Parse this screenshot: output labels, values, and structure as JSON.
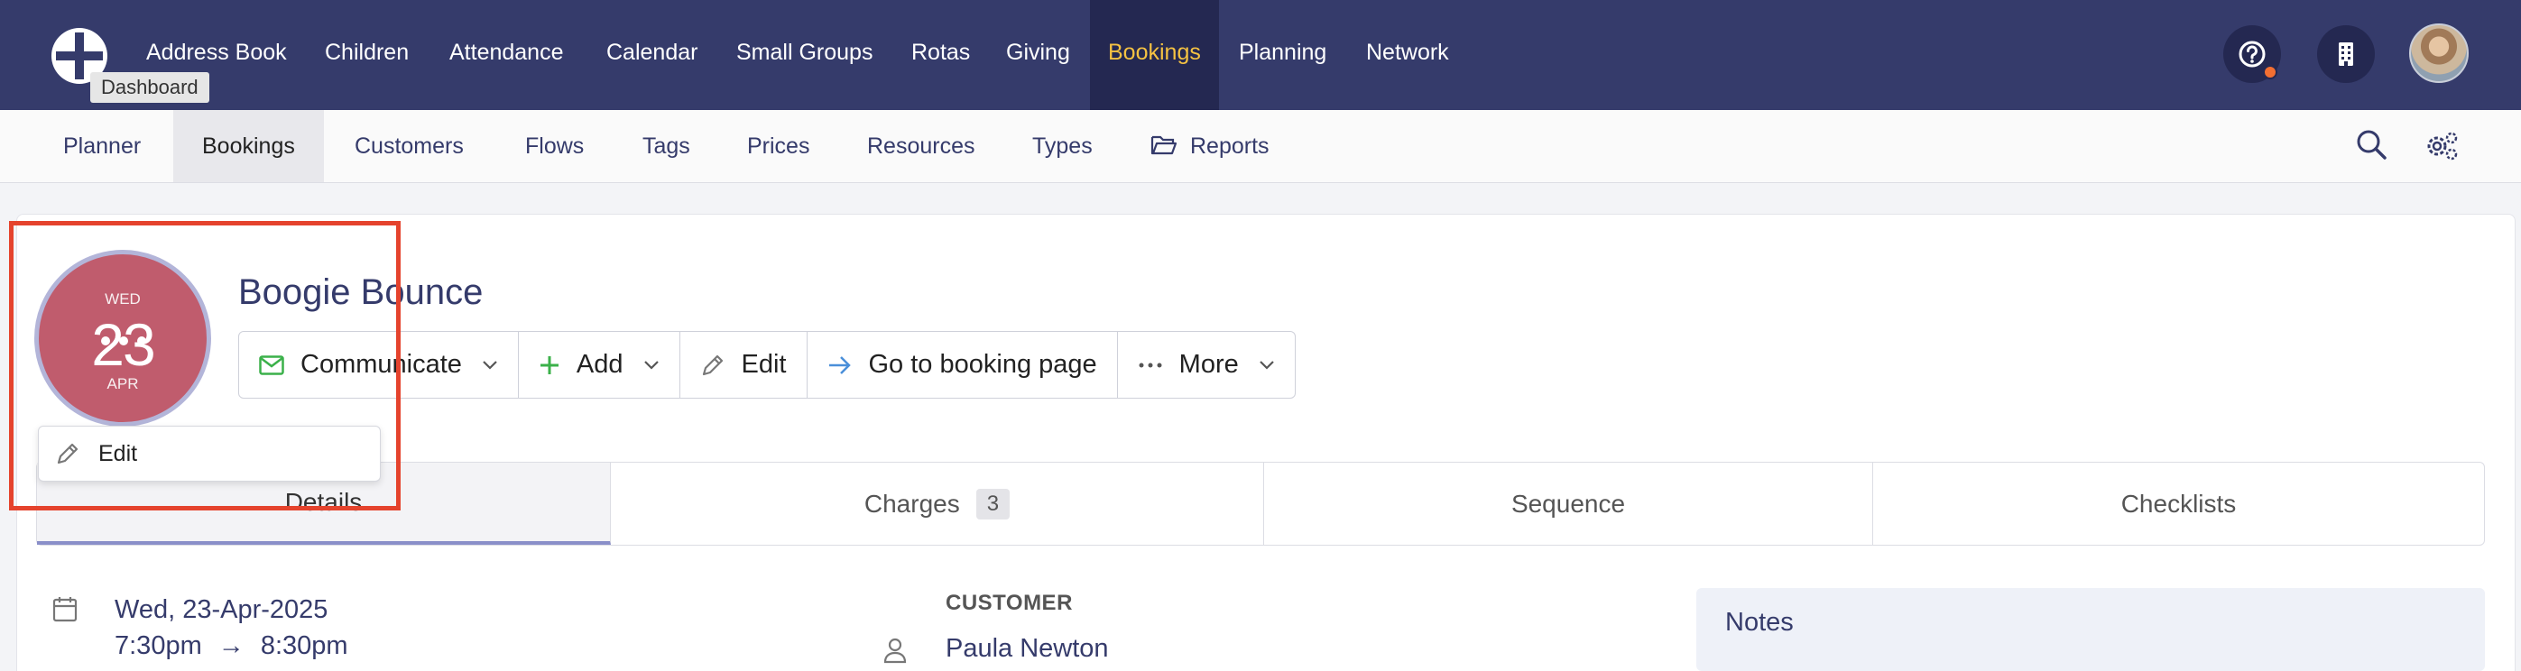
{
  "topnav": {
    "items": [
      "Address Book",
      "Children",
      "Attendance",
      "Calendar",
      "Small Groups",
      "Rotas",
      "Giving",
      "Bookings",
      "Planning",
      "Network"
    ],
    "active": "Bookings",
    "tooltip": "Dashboard"
  },
  "subnav": {
    "items": [
      "Planner",
      "Bookings",
      "Customers",
      "Flows",
      "Tags",
      "Prices",
      "Resources",
      "Types",
      "Reports"
    ],
    "active": "Bookings"
  },
  "booking": {
    "dow": "WED",
    "day": "23",
    "month": "APR",
    "title": "Boogie Bounce"
  },
  "actions": {
    "communicate": "Communicate",
    "add": "Add",
    "edit": "Edit",
    "goto": "Go to booking page",
    "more": "More"
  },
  "popover": {
    "edit": "Edit"
  },
  "tabs": {
    "details": "Details",
    "charges": "Charges",
    "charges_count": "3",
    "sequence": "Sequence",
    "checklists": "Checklists"
  },
  "details": {
    "date": "Wed, 23-Apr-2025",
    "start": "7:30pm",
    "arrow": "→",
    "end": "8:30pm",
    "customer_label": "CUSTOMER",
    "customer_name": "Paula Newton",
    "notes_label": "Notes"
  },
  "colors": {
    "nav_bg": "#353b6b",
    "nav_active_bg": "#242851",
    "nav_active_text": "#f5c242",
    "date_badge": "#c05c6d",
    "highlight": "#e5432d"
  }
}
